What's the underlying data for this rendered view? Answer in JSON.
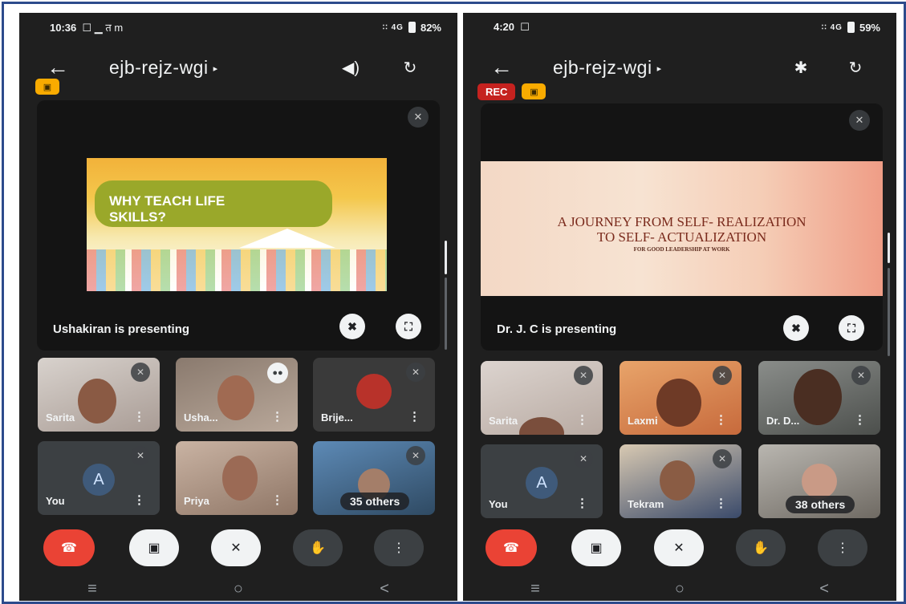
{
  "left_phone": {
    "status": {
      "time": "10:36",
      "notif_icons": "☐ ▁ त m",
      "signal": "∶∶ 4G",
      "battery": "82%"
    },
    "meeting_code": "ejb-rejz-wgi",
    "presenting_label": "Ushakiran is presenting",
    "slide": {
      "title": "WHY TEACH LIFE\nSKILLS?"
    },
    "tiles": [
      {
        "name": "Sarita"
      },
      {
        "name": "Usha..."
      },
      {
        "name": "Brije..."
      },
      {
        "name": "You",
        "avatar_letter": "A"
      },
      {
        "name": "Priya"
      },
      {
        "name": "",
        "others": "35 others"
      }
    ]
  },
  "right_phone": {
    "status": {
      "time": "4:20",
      "signal": "∶∶ 4G",
      "battery": "59%"
    },
    "meeting_code": "ejb-rejz-wgi",
    "rec_badge": "REC",
    "presenting_label": "Dr. J. C is presenting",
    "slide": {
      "title": "A JOURNEY FROM SELF- REALIZATION\nTO SELF- ACTUALIZATION",
      "subtitle": "FOR GOOD LEADERSHIP AT WORK"
    },
    "tiles": [
      {
        "name": "Sarita"
      },
      {
        "name": "Laxmi"
      },
      {
        "name": "Dr. D..."
      },
      {
        "name": "You",
        "avatar_letter": "A"
      },
      {
        "name": "Tekram"
      },
      {
        "name": "",
        "others": "38 others"
      }
    ]
  },
  "icons": {
    "back": "←",
    "caret": "▸",
    "speaker": "◀)",
    "bluetooth": "✱",
    "switch_camera": "↻",
    "mic_off": "✕",
    "pin_off": "✖",
    "fullscreen": "⛶",
    "more": "⋮",
    "end_call": "☎",
    "camera_off": "▣",
    "hand": "✋",
    "nav_recent": "≡",
    "nav_home": "○",
    "nav_back": "<"
  },
  "colors": {
    "end_call": "#ea4335",
    "rec": "#c5221f",
    "border": "#2d4b8c",
    "badge": "#f9ab00"
  }
}
